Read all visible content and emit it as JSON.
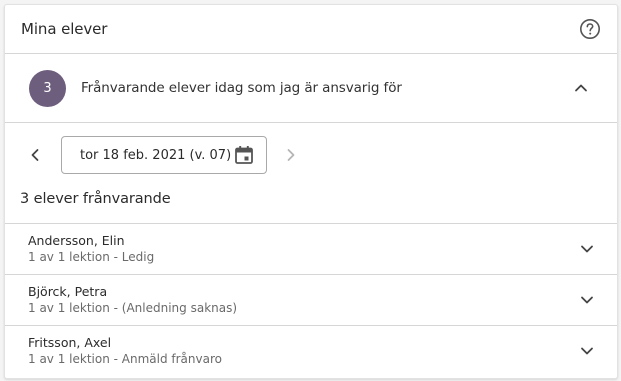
{
  "header": {
    "title": "Mina elever",
    "help_icon": "help-circle-icon"
  },
  "absent_section": {
    "count": "3",
    "title": "Frånvarande elever idag som jag är ansvarig för",
    "badge_color": "#6e5e7e",
    "collapse_icon": "chevron-up-icon"
  },
  "date_picker": {
    "value": "tor 18 feb. 2021 (v. 07)",
    "prev_icon": "chevron-left-icon",
    "next_icon": "chevron-right-icon",
    "calendar_icon": "calendar-icon"
  },
  "summary": "3 elever frånvarande",
  "students": [
    {
      "name": "Andersson, Elin",
      "detail": "1 av 1 lektion - Ledig"
    },
    {
      "name": "Björck, Petra",
      "detail": "1 av 1 lektion - (Anledning saknas)"
    },
    {
      "name": "Fritsson, Axel",
      "detail": "1 av 1 lektion - Anmäld frånvaro"
    }
  ]
}
